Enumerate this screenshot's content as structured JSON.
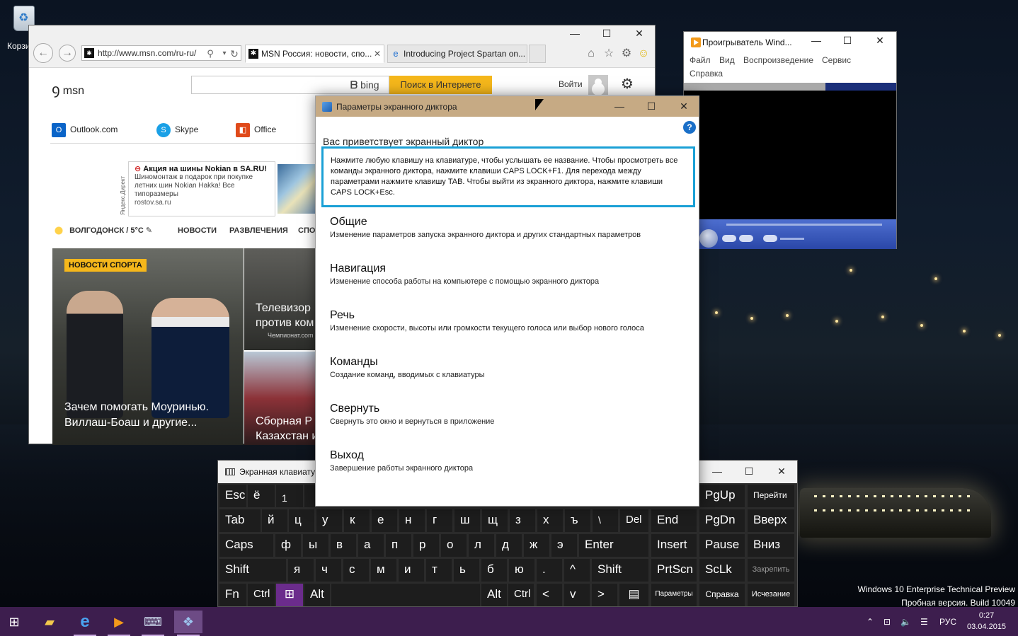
{
  "desktop": {
    "recycle_label": "Корзина",
    "watermark_line1": "Windows 10 Enterprise Technical Preview",
    "watermark_line2": "Пробная версия. Build 10049"
  },
  "ie": {
    "address": "http://www.msn.com/ru-ru/",
    "tab1": "MSN Россия: новости, спо...",
    "tab2": "Introducing Project Spartan on...",
    "msn": "msn",
    "bing": "bing",
    "search_button": "Поиск в Интернете",
    "signin": "Войти",
    "quick_links": [
      "Outlook.com",
      "Skype",
      "Office"
    ],
    "ad_side": "Яндекс.Директ",
    "ad_title": "Акция на шины Nokian в SA.RU!",
    "ad_text": "Шиномонтаж в подарок при покупке летних шин Nokian Hakka! Все типоразмеры",
    "ad_link": "rostov.sa.ru",
    "weather": "ВОЛГОДОНСК / 5°C",
    "categories": [
      "НОВОСТИ",
      "РАЗВЛЕЧЕНИЯ",
      "СПО"
    ],
    "badge": "НОВОСТИ СПОРТА",
    "main_caption": "Зачем помогать Моуринью. Виллаш-Боаш и другие...",
    "side1_caption": "Телевизор против ком",
    "side1_source": "Чемпионат.com",
    "side2_caption": "Сборная Р Казахстан и"
  },
  "wmp": {
    "title": "Проигрыватель Wind...",
    "menu": [
      "Файл",
      "Вид",
      "Воспроизведение",
      "Сервис",
      "Справка"
    ]
  },
  "narrator": {
    "title": "Параметры экранного диктора",
    "welcome": "Вас приветствует экранный диктор",
    "info": "Нажмите любую клавишу на клавиатуре, чтобы услышать ее название. Чтобы просмотреть все команды экранного диктора, нажмите клавиши CAPS LOCK+F1. Для перехода между параметрами нажмите клавишу TAB. Чтобы выйти из экранного диктора, нажмите клавиши CAPS LOCK+Esc.",
    "options": [
      {
        "heading": "Общие",
        "desc": "Изменение параметров запуска экранного диктора и других стандартных параметров"
      },
      {
        "heading": "Навигация",
        "desc": "Изменение способа работы на компьютере с помощью экранного диктора"
      },
      {
        "heading": "Речь",
        "desc": "Изменение скорости, высоты или громкости текущего голоса или выбор нового голоса"
      },
      {
        "heading": "Команды",
        "desc": "Создание команд, вводимых с клавиатуры"
      },
      {
        "heading": "Свернуть",
        "desc": "Свернуть это окно и вернуться в приложение"
      },
      {
        "heading": "Выход",
        "desc": "Завершение работы экранного диктора"
      }
    ]
  },
  "osk": {
    "title": "Экранная клавиатура",
    "row1": [
      "Esc",
      "ё",
      "1"
    ],
    "row1_right": [
      "PgUp",
      "Перейти"
    ],
    "row2": [
      "Tab",
      "й",
      "ц",
      "у",
      "к",
      "е",
      "н",
      "г",
      "ш",
      "щ",
      "з",
      "х",
      "ъ",
      "\\",
      "Del",
      "End",
      "PgDn",
      "Вверх"
    ],
    "row3": [
      "Caps",
      "ф",
      "ы",
      "в",
      "а",
      "п",
      "р",
      "о",
      "л",
      "д",
      "ж",
      "э",
      "Enter",
      "Insert",
      "Pause",
      "Вниз"
    ],
    "row4": [
      "Shift",
      "я",
      "ч",
      "с",
      "м",
      "и",
      "т",
      "ь",
      "б",
      "ю",
      ".",
      "^",
      "Shift",
      "PrtScn",
      "ScLk",
      "Закрепить"
    ],
    "row5": [
      "Fn",
      "Ctrl",
      "Alt",
      "Alt",
      "Ctrl",
      "<",
      "v",
      ">",
      "Параметры",
      "Справка",
      "Исчезание"
    ]
  },
  "taskbar": {
    "lang": "РУС",
    "time": "0:27",
    "date": "03.04.2015"
  },
  "colors": {
    "taskbar": "#3d1e4e",
    "narrator_title": "#c6aa84",
    "info_border": "#1aa0d6",
    "search_accent": "#f5b71b"
  }
}
